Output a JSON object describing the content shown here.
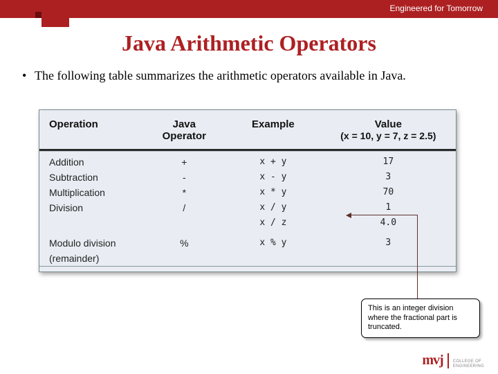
{
  "header": {
    "tagline": "Engineered for Tomorrow"
  },
  "title": "Java Arithmetic Operators",
  "bullet": "The following table summarizes the arithmetic operators available in Java.",
  "table": {
    "headers": {
      "operation": "Operation",
      "java": "Java\nOperator",
      "example": "Example",
      "value_top": "Value",
      "value_sub": "(x = 10, y = 7, z = 2.5)"
    },
    "rows": [
      {
        "op": "Addition",
        "java": "+",
        "ex": "x + y",
        "val": "17"
      },
      {
        "op": "Subtraction",
        "java": "-",
        "ex": "x - y",
        "val": "3"
      },
      {
        "op": "Multiplication",
        "java": "*",
        "ex": "x * y",
        "val": "70"
      },
      {
        "op": "Division",
        "java": "/",
        "ex": "x / y",
        "val": "1"
      },
      {
        "op": "",
        "java": "",
        "ex": "x / z",
        "val": "4.0"
      },
      {
        "op": "Modulo division",
        "java": "%",
        "ex": "x % y",
        "val": "3"
      },
      {
        "op": "(remainder)",
        "java": "",
        "ex": "",
        "val": ""
      }
    ]
  },
  "callout": "This is an integer division where the fractional part is truncated.",
  "logo": {
    "text": "mvj",
    "sub1": "COLLEGE OF",
    "sub2": "ENGINEERING"
  },
  "chart_data": {
    "type": "table",
    "title": "Java Arithmetic Operators",
    "columns": [
      "Operation",
      "Java Operator",
      "Example",
      "Value (x = 10, y = 7, z = 2.5)"
    ],
    "rows": [
      [
        "Addition",
        "+",
        "x + y",
        "17"
      ],
      [
        "Subtraction",
        "-",
        "x - y",
        "3"
      ],
      [
        "Multiplication",
        "*",
        "x * y",
        "70"
      ],
      [
        "Division",
        "/",
        "x / y",
        "1"
      ],
      [
        "Division",
        "/",
        "x / z",
        "4.0"
      ],
      [
        "Modulo division (remainder)",
        "%",
        "x % y",
        "3"
      ]
    ]
  }
}
